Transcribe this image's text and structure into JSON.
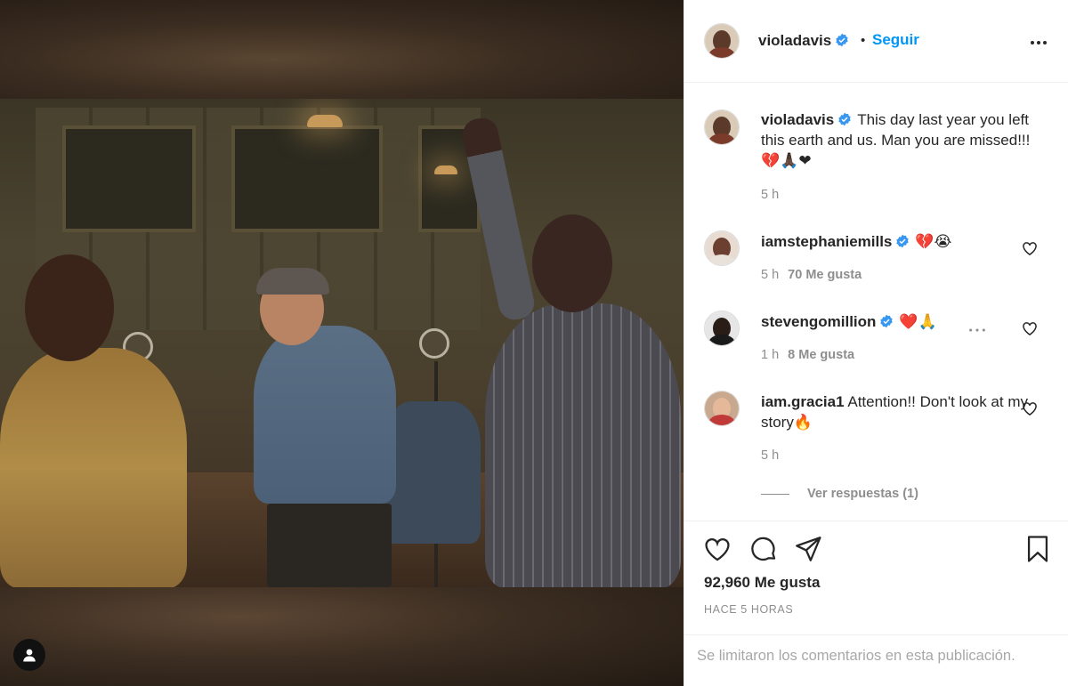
{
  "post": {
    "author": "violadavis",
    "follow_label": "Seguir",
    "separator": "•",
    "caption_text": "This day last year you left this earth and us. Man you are missed!!! 💔🙏🏿❤",
    "caption_time": "5 h",
    "likes_text": "92,960 Me gusta",
    "posted_time": "HACE 5 HORAS",
    "comments_limited": "Se limitaron los comentarios en esta publicación."
  },
  "comments": [
    {
      "username": "iamstephaniemills",
      "text": "💔😭",
      "time": "5 h",
      "likes": "70 Me gusta"
    },
    {
      "username": "stevengomillion",
      "text": "❤️🙏",
      "time": "1 h",
      "likes": "8 Me gusta"
    },
    {
      "username": "iam.gracia1",
      "text": "Attention!! Don't look at my story🔥",
      "time": "5 h"
    }
  ],
  "replies_label": "Ver respuestas (1)",
  "icons": {
    "more": "more-horizontal-icon",
    "verified": "verified-badge-icon",
    "like": "heart-icon",
    "comment": "comment-bubble-icon",
    "share": "paper-plane-icon",
    "save": "bookmark-icon",
    "tagged_user": "person-icon"
  },
  "colors": {
    "link": "#0095f6",
    "verified": "#3897f0",
    "muted": "#8e8e8e",
    "text": "#262626"
  }
}
